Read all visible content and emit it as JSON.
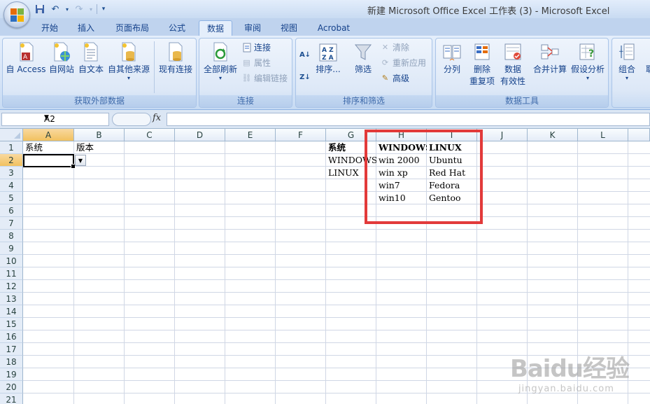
{
  "window": {
    "title": "新建 Microsoft Office Excel 工作表 (3) - Microsoft Excel"
  },
  "tabs": [
    {
      "label": "开始",
      "active": false
    },
    {
      "label": "插入",
      "active": false
    },
    {
      "label": "页面布局",
      "active": false
    },
    {
      "label": "公式",
      "active": false
    },
    {
      "label": "数据",
      "active": true
    },
    {
      "label": "审阅",
      "active": false
    },
    {
      "label": "视图",
      "active": false
    },
    {
      "label": "Acrobat",
      "active": false
    }
  ],
  "ribbon": {
    "external": {
      "label": "获取外部数据",
      "access": "自 Access",
      "web": "自网站",
      "text": "自文本",
      "other": "自其他来源",
      "existing": "现有连接"
    },
    "connections": {
      "label": "连接",
      "refresh_all": "全部刷新",
      "connections": "连接",
      "properties": "属性",
      "edit_links": "编辑链接"
    },
    "sortfilter": {
      "label": "排序和筛选",
      "sort": "排序...",
      "filter": "筛选",
      "clear": "清除",
      "reapply": "重新应用",
      "advanced": "高级"
    },
    "datatools": {
      "label": "数据工具",
      "text_to_columns": "分列",
      "remove_dup_1": "删除",
      "remove_dup_2": "重复项",
      "validation_1": "数据",
      "validation_2": "有效性",
      "consolidate": "合并计算",
      "whatif": "假设分析"
    },
    "outline": {
      "group": "组合",
      "ungroup_partial": "取"
    }
  },
  "formula_bar": {
    "name_box": "A2",
    "fx": "fx",
    "formula": ""
  },
  "sheet": {
    "columns": [
      "A",
      "B",
      "C",
      "D",
      "E",
      "F",
      "G",
      "H",
      "I",
      "J",
      "K",
      "L"
    ],
    "rows": [
      "1",
      "2",
      "3",
      "4",
      "5",
      "6",
      "7",
      "8",
      "9",
      "10",
      "11",
      "12",
      "13",
      "14",
      "15",
      "16",
      "17",
      "18",
      "19",
      "20",
      "21"
    ],
    "cells": {
      "A1": "系统",
      "B1": "版本",
      "G1": "系统",
      "G2": "WINDOWS",
      "G3": "LINUX",
      "H1": "WINDOWS",
      "H2": "win 2000",
      "H3": "win xp",
      "H4": "win7",
      "H5": "win10",
      "I1": "LINUX",
      "I2": "Ubuntu",
      "I3": "Red Hat",
      "I4": "Fedora",
      "I5": "Gentoo"
    },
    "active_cell": "A2",
    "highlight_color": "#e23a3a"
  },
  "watermark": {
    "logo": "Baidu经验",
    "url": "jingyan.baidu.com"
  }
}
